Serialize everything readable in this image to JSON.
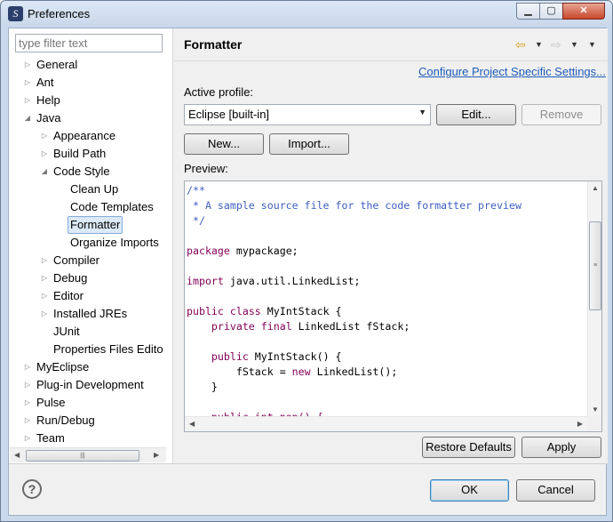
{
  "window": {
    "title": "Preferences",
    "minimize": "▁",
    "maximize": "▢",
    "close": "✕"
  },
  "filter": {
    "placeholder": "type filter text"
  },
  "tree": {
    "expanded_glyph": "◢",
    "collapsed_glyph": "▷",
    "items": [
      {
        "label": "General",
        "expander": "▷"
      },
      {
        "label": "Ant",
        "expander": "▷"
      },
      {
        "label": "Help",
        "expander": "▷"
      },
      {
        "label": "Java",
        "expander": "◢"
      },
      {
        "label": "Appearance",
        "expander": "▷"
      },
      {
        "label": "Build Path",
        "expander": "▷"
      },
      {
        "label": "Code Style",
        "expander": "◢"
      },
      {
        "label": "Clean Up",
        "expander": ""
      },
      {
        "label": "Code Templates",
        "expander": ""
      },
      {
        "label": "Formatter",
        "expander": ""
      },
      {
        "label": "Organize Imports",
        "expander": ""
      },
      {
        "label": "Compiler",
        "expander": "▷"
      },
      {
        "label": "Debug",
        "expander": "▷"
      },
      {
        "label": "Editor",
        "expander": "▷"
      },
      {
        "label": "Installed JREs",
        "expander": "▷"
      },
      {
        "label": "JUnit",
        "expander": ""
      },
      {
        "label": "Properties Files Edito",
        "expander": ""
      },
      {
        "label": "MyEclipse",
        "expander": "▷"
      },
      {
        "label": "Plug-in Development",
        "expander": "▷"
      },
      {
        "label": "Pulse",
        "expander": "▷"
      },
      {
        "label": "Run/Debug",
        "expander": "▷"
      },
      {
        "label": "Team",
        "expander": "▷"
      }
    ]
  },
  "page": {
    "title": "Formatter",
    "back_icon": "⇦",
    "forward_icon": "⇨",
    "dropdown_glyph": "▼",
    "menu_glyph": "▼",
    "configure_link": "Configure Project Specific Settings...",
    "active_profile_label": "Active profile:",
    "profile_value": "Eclipse [built-in]",
    "edit_button": "Edit...",
    "remove_button": "Remove",
    "new_button": "New...",
    "import_button": "Import...",
    "preview_label": "Preview:",
    "restore_button": "Restore Defaults",
    "apply_button": "Apply"
  },
  "preview": {
    "lines": [
      [
        {
          "t": "/**",
          "c": "cm"
        }
      ],
      [
        {
          "t": " * A sample source file for the code formatter preview",
          "c": "cm"
        }
      ],
      [
        {
          "t": " */",
          "c": "cm"
        }
      ],
      [],
      [
        {
          "t": "package",
          "c": "kw"
        },
        {
          "t": " mypackage;",
          "c": ""
        }
      ],
      [],
      [
        {
          "t": "import",
          "c": "kw"
        },
        {
          "t": " java.util.LinkedList;",
          "c": ""
        }
      ],
      [],
      [
        {
          "t": "public",
          "c": "kw"
        },
        {
          "t": " ",
          "c": ""
        },
        {
          "t": "class",
          "c": "kw"
        },
        {
          "t": " MyIntStack {",
          "c": ""
        }
      ],
      [
        {
          "t": "    ",
          "c": ""
        },
        {
          "t": "private",
          "c": "kw"
        },
        {
          "t": " ",
          "c": ""
        },
        {
          "t": "final",
          "c": "kw"
        },
        {
          "t": " LinkedList fStack;",
          "c": ""
        }
      ],
      [],
      [
        {
          "t": "    ",
          "c": ""
        },
        {
          "t": "public",
          "c": "kw"
        },
        {
          "t": " MyIntStack() {",
          "c": ""
        }
      ],
      [
        {
          "t": "        fStack = ",
          "c": ""
        },
        {
          "t": "new",
          "c": "kw"
        },
        {
          "t": " LinkedList();",
          "c": ""
        }
      ],
      [
        {
          "t": "    }",
          "c": ""
        }
      ],
      [],
      [
        {
          "t": "    public int pop() {",
          "c": "kw"
        }
      ]
    ]
  },
  "footer": {
    "help_icon": "?",
    "ok_button": "OK",
    "cancel_button": "Cancel"
  },
  "colors": {
    "link": "#1c5bb8",
    "keyword": "#7f0055",
    "comment": "#3f5fbf"
  }
}
